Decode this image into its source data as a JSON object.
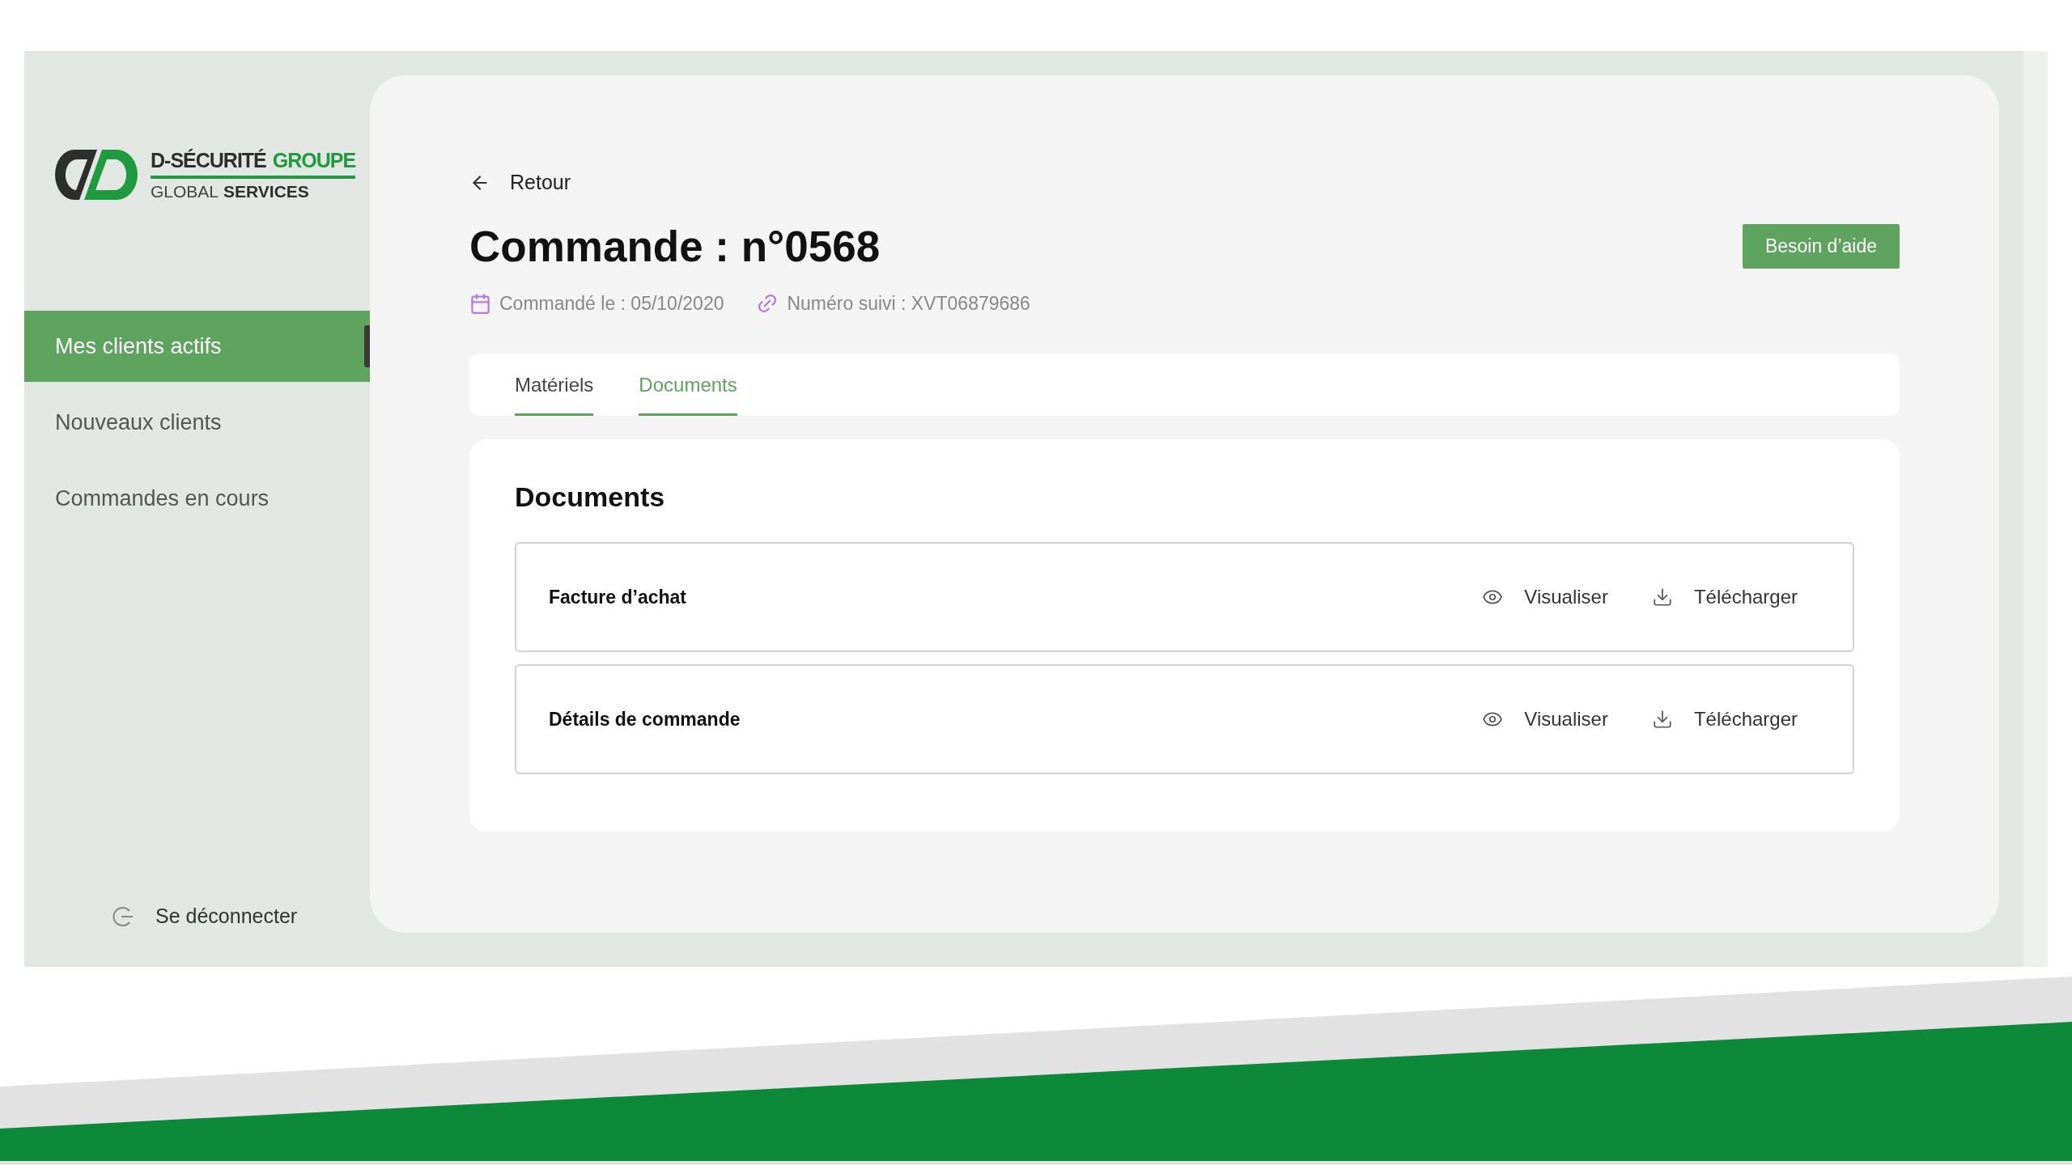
{
  "logo": {
    "name": "D-SÉCURITÉ",
    "accent": "GROUPE",
    "subtitle_light": "GLOBAL",
    "subtitle_bold": "SERVICES"
  },
  "sidebar": {
    "items": [
      {
        "label": "Mes clients actifs",
        "selected": true
      },
      {
        "label": "Nouveaux clients",
        "selected": false
      },
      {
        "label": "Commandes en cours",
        "selected": false
      }
    ],
    "logout": "Se déconnecter"
  },
  "back": "Retour",
  "title": "Commande : n°0568",
  "help_button": "Besoin d’aide",
  "meta": {
    "ordered": "Commandé le : 05/10/2020",
    "tracking": "Numéro suivi : XVT06879686"
  },
  "tabs": [
    {
      "label": "Matériels",
      "selected": false
    },
    {
      "label": "Documents",
      "selected": true
    }
  ],
  "documents": {
    "heading": "Documents",
    "rows": [
      {
        "name": "Facture d’achat",
        "view": "Visualiser",
        "download": "Télécharger"
      },
      {
        "name": "Détails de commande",
        "view": "Visualiser",
        "download": "Télécharger"
      }
    ]
  }
}
